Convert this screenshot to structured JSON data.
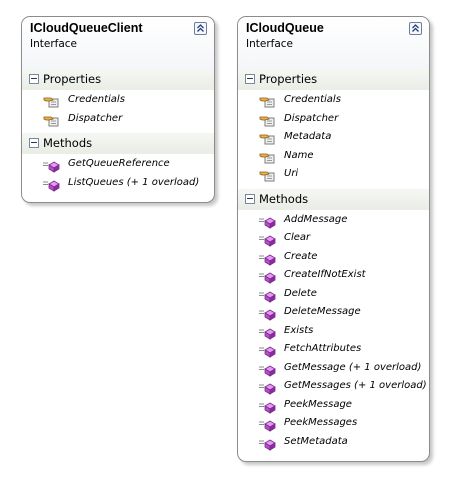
{
  "client": {
    "title": "ICloudQueueClient",
    "subtitle": "Interface",
    "properties_label": "Properties",
    "properties": [
      "Credentials",
      "Dispatcher"
    ],
    "methods_label": "Methods",
    "methods": [
      "GetQueueReference",
      "ListQueues (+ 1 overload)"
    ]
  },
  "queue": {
    "title": "ICloudQueue",
    "subtitle": "Interface",
    "properties_label": "Properties",
    "properties": [
      "Credentials",
      "Dispatcher",
      "Metadata",
      "Name",
      "Uri"
    ],
    "methods_label": "Methods",
    "methods": [
      "AddMessage",
      "Clear",
      "Create",
      "CreateIfNotExist",
      "Delete",
      "DeleteMessage",
      "Exists",
      "FetchAttributes",
      "GetMessage (+ 1 overload)",
      "GetMessages (+ 1 overload)",
      "PeekMessage",
      "PeekMessages",
      "SetMetadata"
    ]
  },
  "icons": {
    "property": "property-hand-icon",
    "method": "method-cube-icon",
    "collapse": "double-chevron-up-icon",
    "section": "minus-square-icon"
  },
  "colors": {
    "method_icon": "#b64fc8",
    "property_icon": "#d8a63a",
    "section_band": "#e9ede6"
  }
}
